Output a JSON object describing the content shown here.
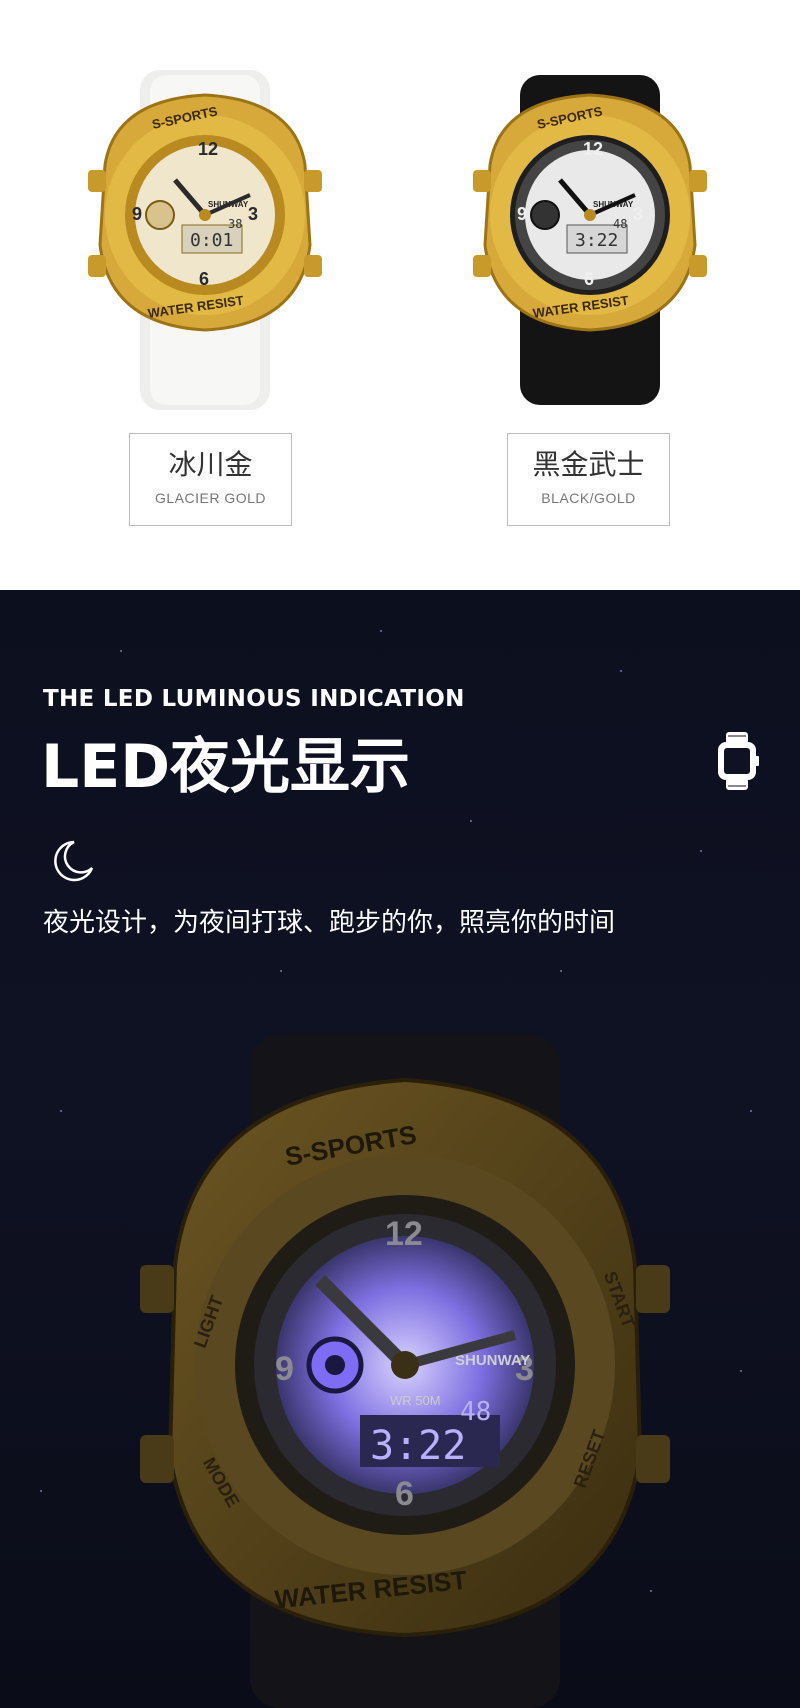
{
  "variants": [
    {
      "name_cn": "冰川金",
      "name_en": "GLACIER GOLD"
    },
    {
      "name_cn": "黑金武士",
      "name_en": "BLACK/GOLD"
    }
  ],
  "watch_face": {
    "brand_top": "S-SPORTS",
    "brand_bottom": "WATER RESIST",
    "logo": "SHUNWAY",
    "wr": "WR 50M",
    "light": "LIGHT",
    "start": "START",
    "mode": "MODE",
    "reset": "RESET",
    "n12": "12",
    "n3": "3",
    "n6": "6",
    "n9": "9",
    "digital_main_gold": "0:01",
    "digital_small_gold": "38",
    "digital_main": "3:22",
    "digital_small": "48"
  },
  "feature": {
    "title_en": "THE LED LUMINOUS INDICATION",
    "title_cn": "LED夜光显示",
    "description": "夜光设计，为夜间打球、跑步的你，照亮你的时间",
    "moon_icon": "crescent-moon-icon",
    "watch_icon": "watch-icon"
  },
  "colors": {
    "gold": "#d4a52a",
    "night_bg": "#0f1223",
    "glow": "#9b8cff"
  }
}
